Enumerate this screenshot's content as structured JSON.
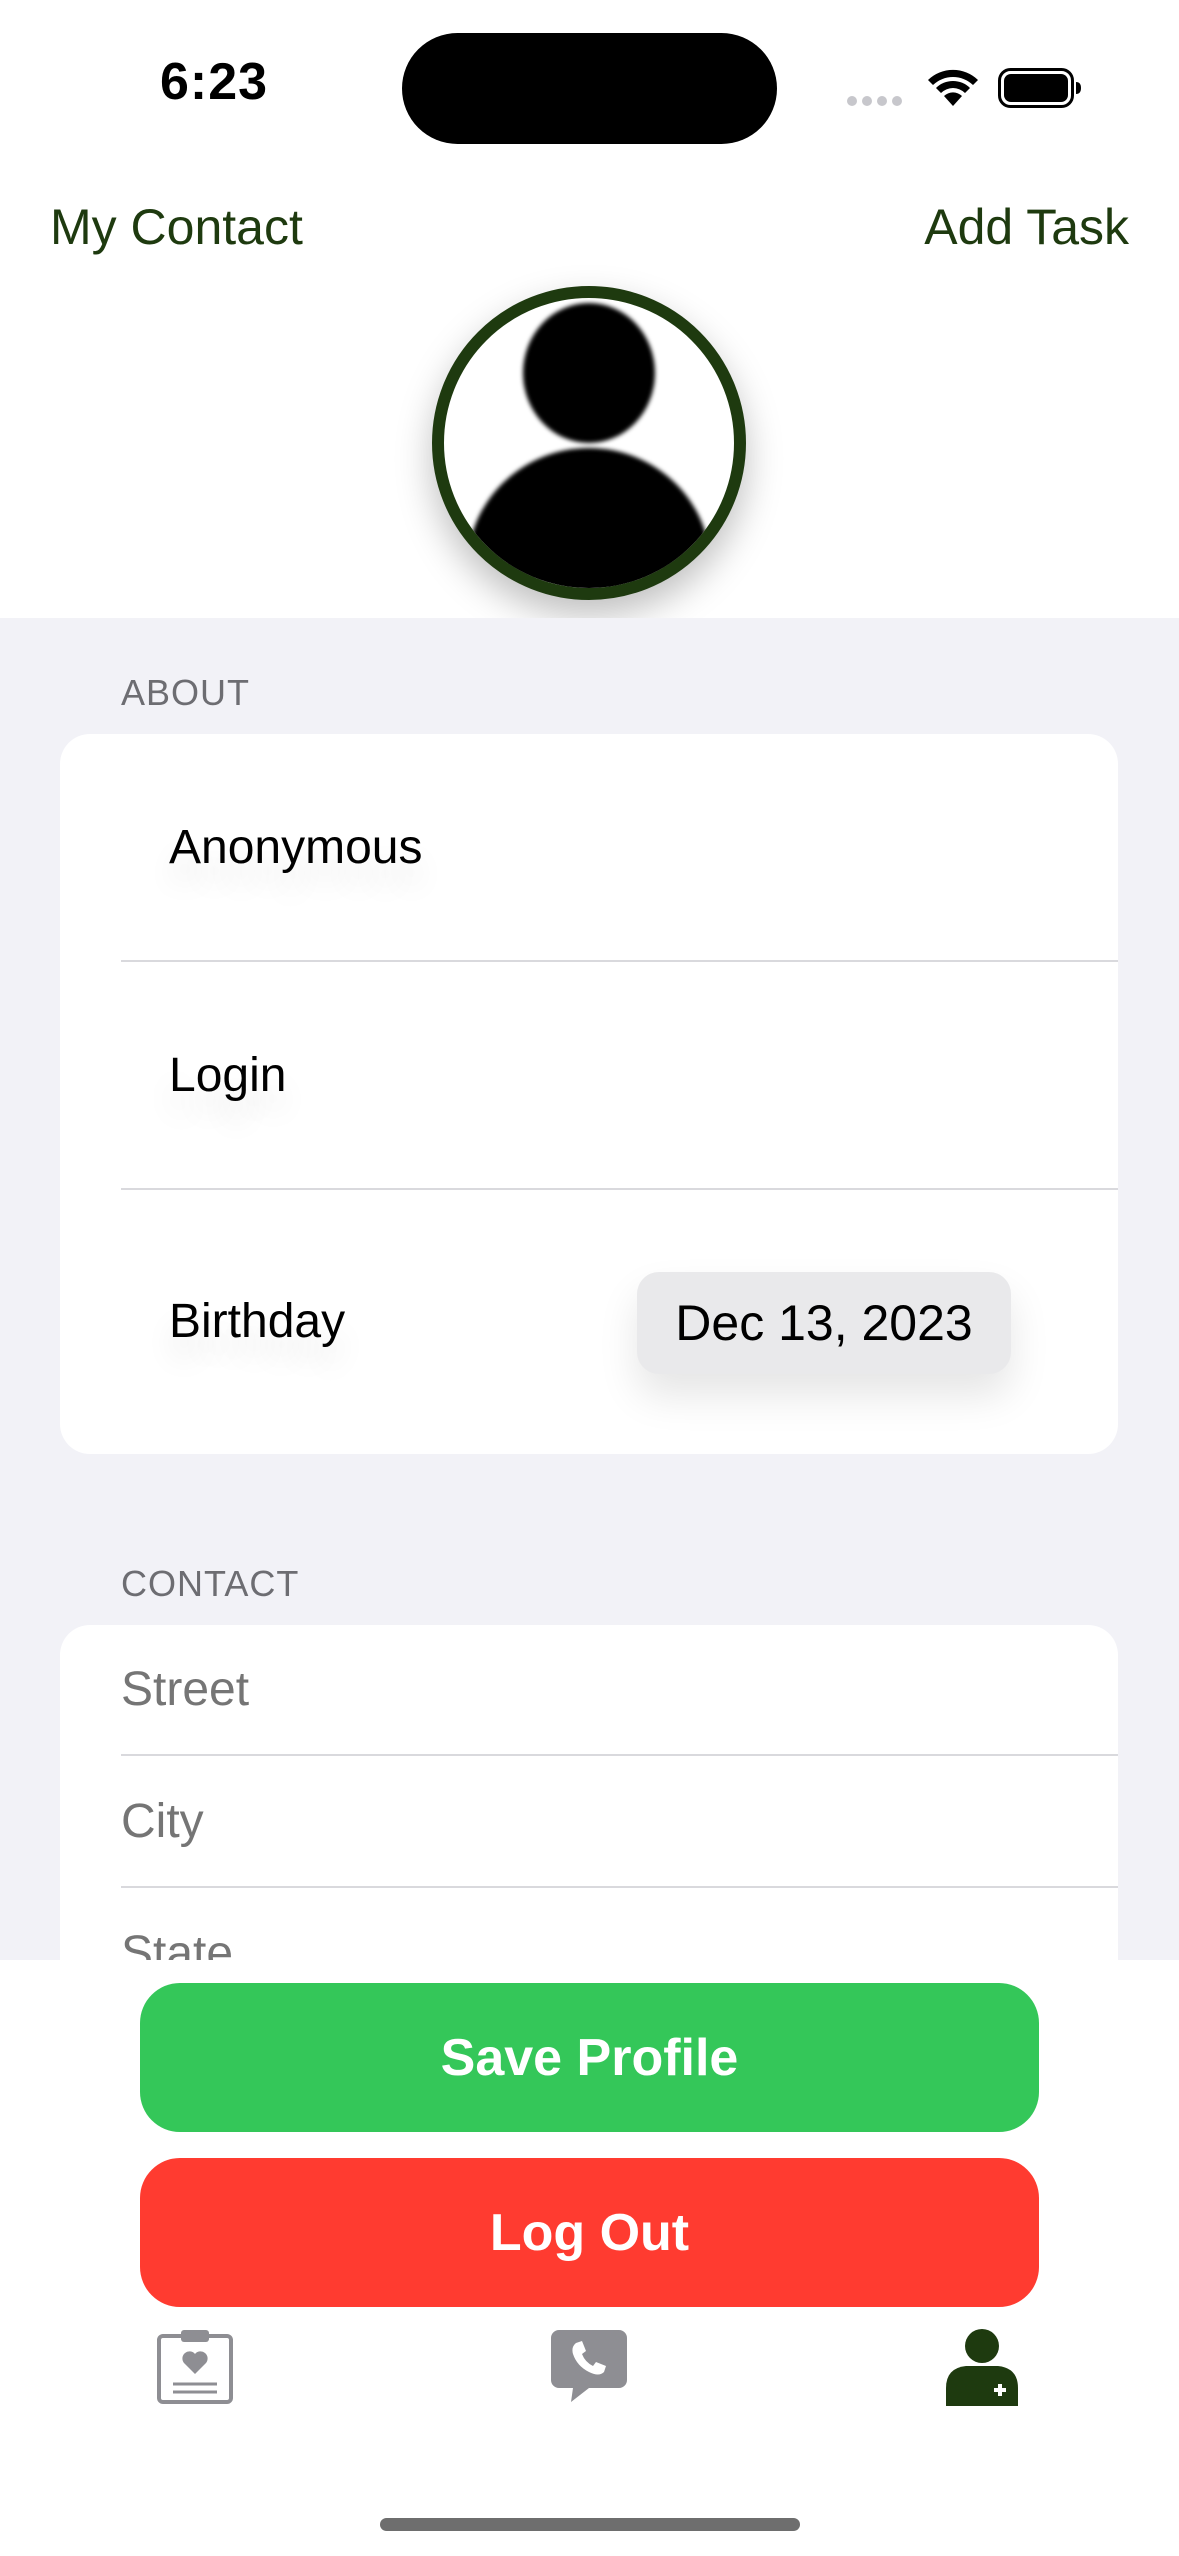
{
  "status_bar": {
    "time": "6:23"
  },
  "nav": {
    "left_label": "My Contact",
    "right_label": "Add Task"
  },
  "about": {
    "header": "ABOUT",
    "name": "Anonymous",
    "login": "Login",
    "birthday_label": "Birthday",
    "birthday_value": "Dec 13, 2023"
  },
  "contact": {
    "header": "CONTACT",
    "street_placeholder": "Street",
    "city_placeholder": "City",
    "state_placeholder": "State"
  },
  "actions": {
    "save_label": "Save Profile",
    "logout_label": "Log Out"
  },
  "tabs": [
    {
      "icon": "clipboard-heart-icon"
    },
    {
      "icon": "phone-bubble-icon"
    },
    {
      "icon": "person-medical-icon",
      "selected": true
    }
  ],
  "colors": {
    "accent": "#1e3a0f",
    "save": "#34c759",
    "logout": "#ff3b30",
    "group_background": "#f2f2f7",
    "tab_inactive": "#8e8e93"
  }
}
